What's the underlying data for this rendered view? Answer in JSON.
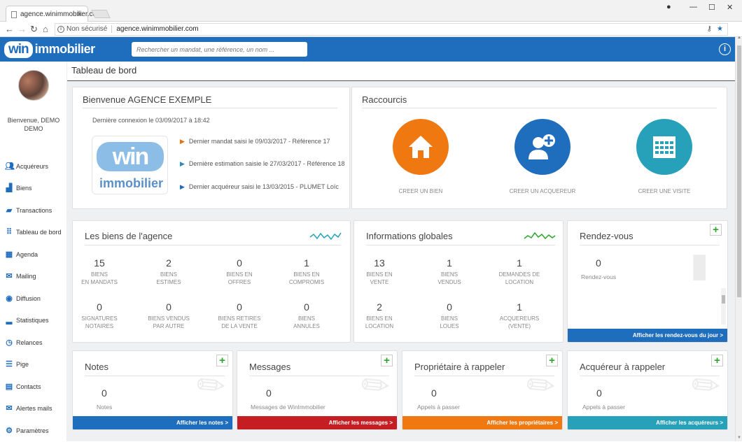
{
  "browser": {
    "tab_title": "agence.winimmobilier.co",
    "not_secure": "Non sécurisé",
    "url": "agence.winimmobilier.com"
  },
  "app": {
    "logo_win": "win",
    "logo_immobilier": "immobilier",
    "search_placeholder": "Rechercher un mandat, une référence, un nom ..."
  },
  "sidebar": {
    "welcome_line1": "Bienvenue, DEMO",
    "welcome_line2": "DEMO",
    "items": [
      {
        "label": "Acquéreurs",
        "icon": "users-icon"
      },
      {
        "label": "Biens",
        "icon": "building-icon"
      },
      {
        "label": "Transactions",
        "icon": "briefcase-icon"
      },
      {
        "label": "Tableau de bord",
        "icon": "grid-icon"
      },
      {
        "label": "Agenda",
        "icon": "calendar-icon"
      },
      {
        "label": "Mailing",
        "icon": "envelope-icon"
      },
      {
        "label": "Diffusion",
        "icon": "broadcast-icon"
      },
      {
        "label": "Statistiques",
        "icon": "bar-chart-icon"
      },
      {
        "label": "Relances",
        "icon": "clock-icon"
      },
      {
        "label": "Pige",
        "icon": "list-icon"
      },
      {
        "label": "Contacts",
        "icon": "contact-card-icon"
      },
      {
        "label": "Alertes mails",
        "icon": "alert-mail-icon"
      },
      {
        "label": "Paramètres",
        "icon": "gear-icon"
      }
    ]
  },
  "page_title": "Tableau de bord",
  "welcome": {
    "title": "Bienvenue AGENCE EXEMPLE",
    "last_login": "Dernière connexion le 03/09/2017 à 18:42",
    "recent": [
      {
        "text": "Dernier mandat saisi le 09/03/2017 - Référence 17",
        "color": "#e8700d"
      },
      {
        "text": "Dernière estimation saisie le 27/03/2017 - Référence 18",
        "color": "#2a8ab7"
      },
      {
        "text": "Dernier acquéreur saisi le 13/03/2015 - PLUMET Loïc",
        "color": "#1f6dbd"
      }
    ]
  },
  "shortcuts": {
    "title": "Raccourcis",
    "items": [
      {
        "label": "CREER UN BIEN",
        "color": "#f07811",
        "icon": "house-icon"
      },
      {
        "label": "CREER UN ACQUEREUR",
        "color": "#1f6dbd",
        "icon": "add-user-icon"
      },
      {
        "label": "CREER UNE VISITE",
        "color": "#26a1b9",
        "icon": "calendar-grid-icon"
      }
    ]
  },
  "agency_goods": {
    "title": "Les biens de l'agence",
    "stats": [
      {
        "n": "15",
        "l1": "BIENS",
        "l2": "EN MANDATS"
      },
      {
        "n": "2",
        "l1": "BIENS",
        "l2": "ESTIMES"
      },
      {
        "n": "0",
        "l1": "BIENS EN",
        "l2": "OFFRES"
      },
      {
        "n": "1",
        "l1": "BIENS EN",
        "l2": "COMPROMIS"
      },
      {
        "n": "0",
        "l1": "SIGNATURES",
        "l2": "NOTAIRES"
      },
      {
        "n": "0",
        "l1": "BIENS VENDUS",
        "l2": "PAR AUTRE"
      },
      {
        "n": "0",
        "l1": "BIENS RETIRES",
        "l2": "DE LA VENTE"
      },
      {
        "n": "0",
        "l1": "BIENS",
        "l2": "ANNULES"
      }
    ]
  },
  "global_info": {
    "title": "Informations globales",
    "stats": [
      {
        "n": "13",
        "l1": "BIENS EN",
        "l2": "VENTE"
      },
      {
        "n": "1",
        "l1": "BIENS",
        "l2": "VENDUS"
      },
      {
        "n": "1",
        "l1": "DEMANDES DE",
        "l2": "LOCATION"
      },
      {
        "n": "2",
        "l1": "BIENS EN",
        "l2": "LOCATION"
      },
      {
        "n": "0",
        "l1": "BIENS",
        "l2": "LOUES"
      },
      {
        "n": "1",
        "l1": "ACQUEREURS",
        "l2": "(VENTE)"
      }
    ]
  },
  "appointments": {
    "title": "Rendez-vous",
    "count": "0",
    "label": "Rendez-vous",
    "footer": "Afficher les rendez-vous du jour >",
    "color": "#1f6dbd"
  },
  "cards": [
    {
      "title": "Notes",
      "count": "0",
      "label": "Notes",
      "footer": "Afficher les notes >",
      "color": "#1f6dbd"
    },
    {
      "title": "Messages",
      "count": "0",
      "label": "Messages de WinImmobilier",
      "footer": "Afficher les messages >",
      "color": "#c41e22"
    },
    {
      "title": "Propriétaire à rappeler",
      "count": "0",
      "label": "Appels à passer",
      "footer": "Afficher les propriétaires >",
      "color": "#f07811"
    },
    {
      "title": "Acquéreur à rappeler",
      "count": "0",
      "label": "Appels à passer",
      "footer": "Afficher les acquéreurs >",
      "color": "#26a1b9"
    }
  ]
}
